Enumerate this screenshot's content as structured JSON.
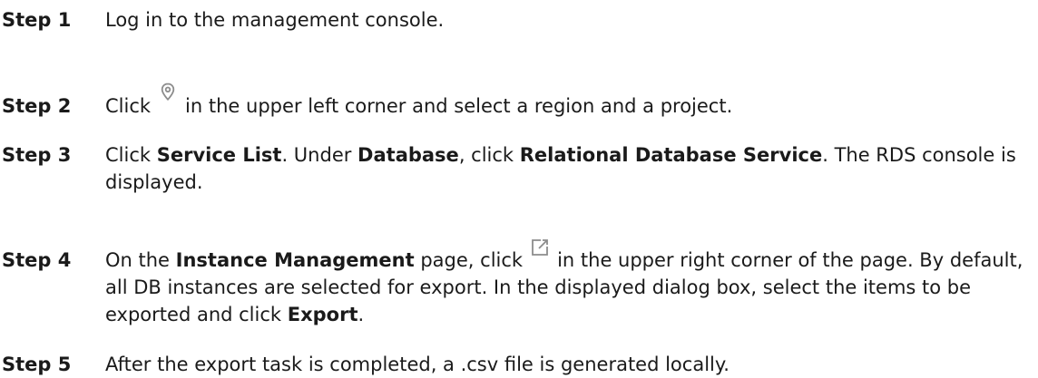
{
  "steps": [
    {
      "label": "Step 1",
      "text": "Log in to the management console."
    },
    {
      "label": "Step 2",
      "before": "Click",
      "icon": "location-pin-icon",
      "after": "in the upper left corner and select a region and a project."
    },
    {
      "label": "Step 3",
      "t1": "Click ",
      "b1": "Service List",
      "t2": ". Under ",
      "b2": "Database",
      "t3": ", click ",
      "b3": "Relational Database Service",
      "t4": ". The RDS console is displayed."
    },
    {
      "label": "Step 4",
      "t1": "On the ",
      "b1": "Instance Management",
      "t2": " page, click",
      "icon": "export-icon",
      "t3": "in the upper right corner of the page. By default, all DB instances are selected for export. In the displayed dialog box, select the items to be exported and click ",
      "b2": "Export",
      "t4": "."
    },
    {
      "label": "Step 5",
      "text": "After the export task is completed, a .csv file is generated locally."
    }
  ],
  "colors": {
    "text": "#1a1a1a",
    "icon": "#8c8c8c"
  }
}
